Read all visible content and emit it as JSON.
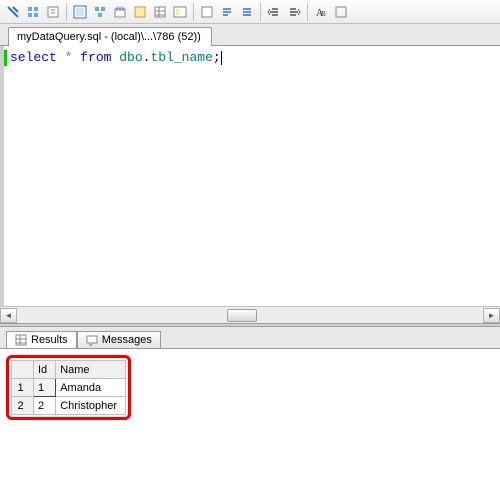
{
  "toolbar": {
    "icons": [
      "execute",
      "debug",
      "parse",
      "display-plan",
      "query-options",
      "intellisense",
      "sqlcmd",
      "results-grid",
      "results-text",
      "results-file",
      "comment",
      "uncomment",
      "indent-dec",
      "indent-inc",
      "format",
      "specify-values"
    ]
  },
  "fileTab": {
    "title": "myDataQuery.sql - (local)\\...\\786 (52))"
  },
  "editor": {
    "kw_select": "select",
    "star": " * ",
    "kw_from": "from",
    "space": " ",
    "obj1": "dbo",
    "dot": ".",
    "obj2": "tbl_name",
    "semi": ";"
  },
  "resultsTabs": {
    "results": "Results",
    "messages": "Messages"
  },
  "grid": {
    "cornerHeader": "",
    "columns": [
      "Id",
      "Name"
    ],
    "rows": [
      {
        "rownum": "1",
        "cells": [
          "1",
          "Amanda"
        ]
      },
      {
        "rownum": "2",
        "cells": [
          "2",
          "Christopher"
        ]
      }
    ]
  }
}
